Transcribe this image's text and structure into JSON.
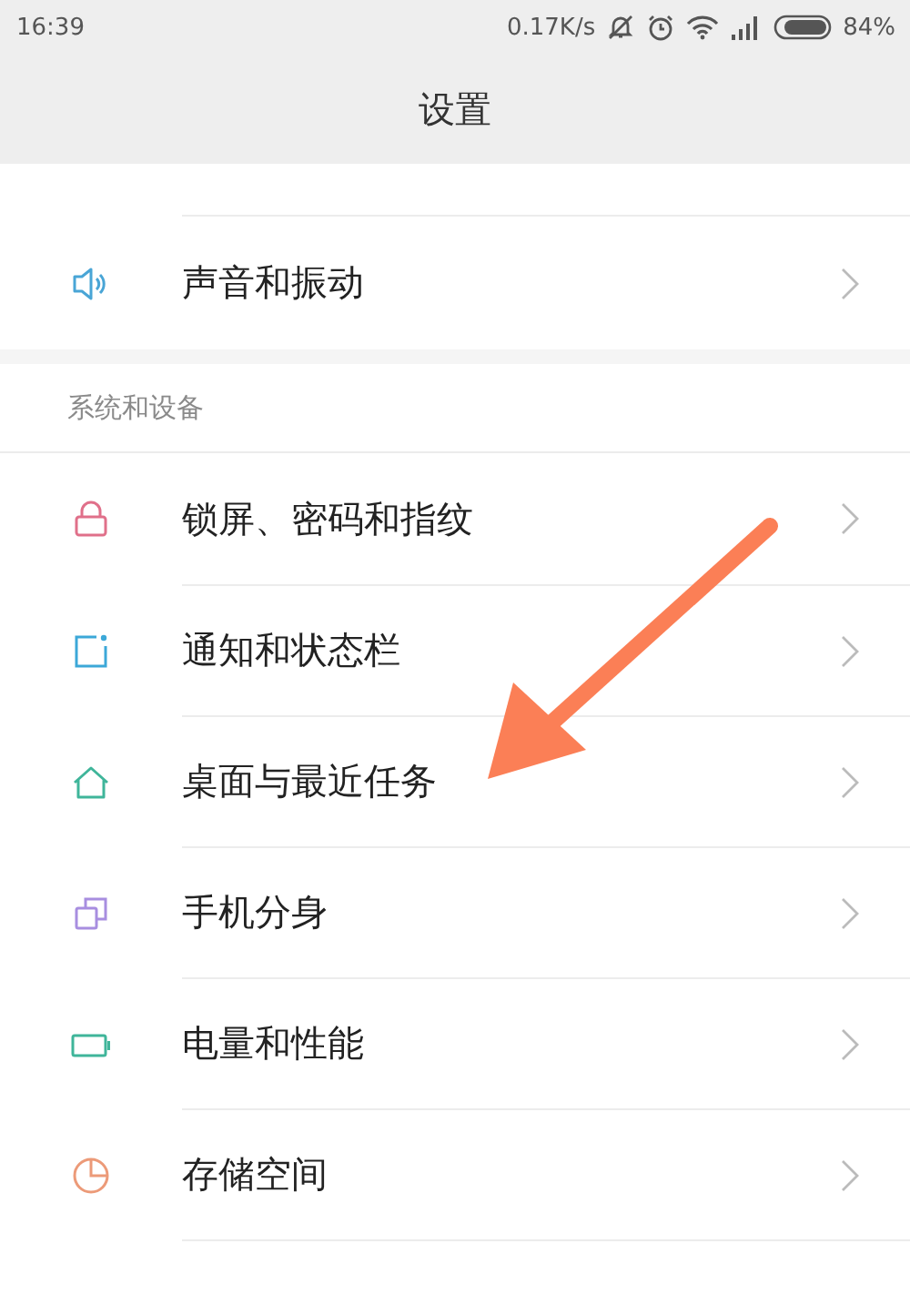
{
  "status_bar": {
    "time": "16:39",
    "speed": "0.17K/s",
    "battery": "84%"
  },
  "header": {
    "title": "设置"
  },
  "groups": [
    {
      "items": [
        {
          "label": "声音和振动",
          "kind": "sound"
        }
      ]
    },
    {
      "title": "系统和设备",
      "items": [
        {
          "label": "锁屏、密码和指纹",
          "kind": "lock"
        },
        {
          "label": "通知和状态栏",
          "kind": "notify"
        },
        {
          "label": "桌面与最近任务",
          "kind": "home"
        },
        {
          "label": "手机分身",
          "kind": "clone"
        },
        {
          "label": "电量和性能",
          "kind": "battery"
        },
        {
          "label": "存储空间",
          "kind": "storage"
        }
      ]
    }
  ]
}
